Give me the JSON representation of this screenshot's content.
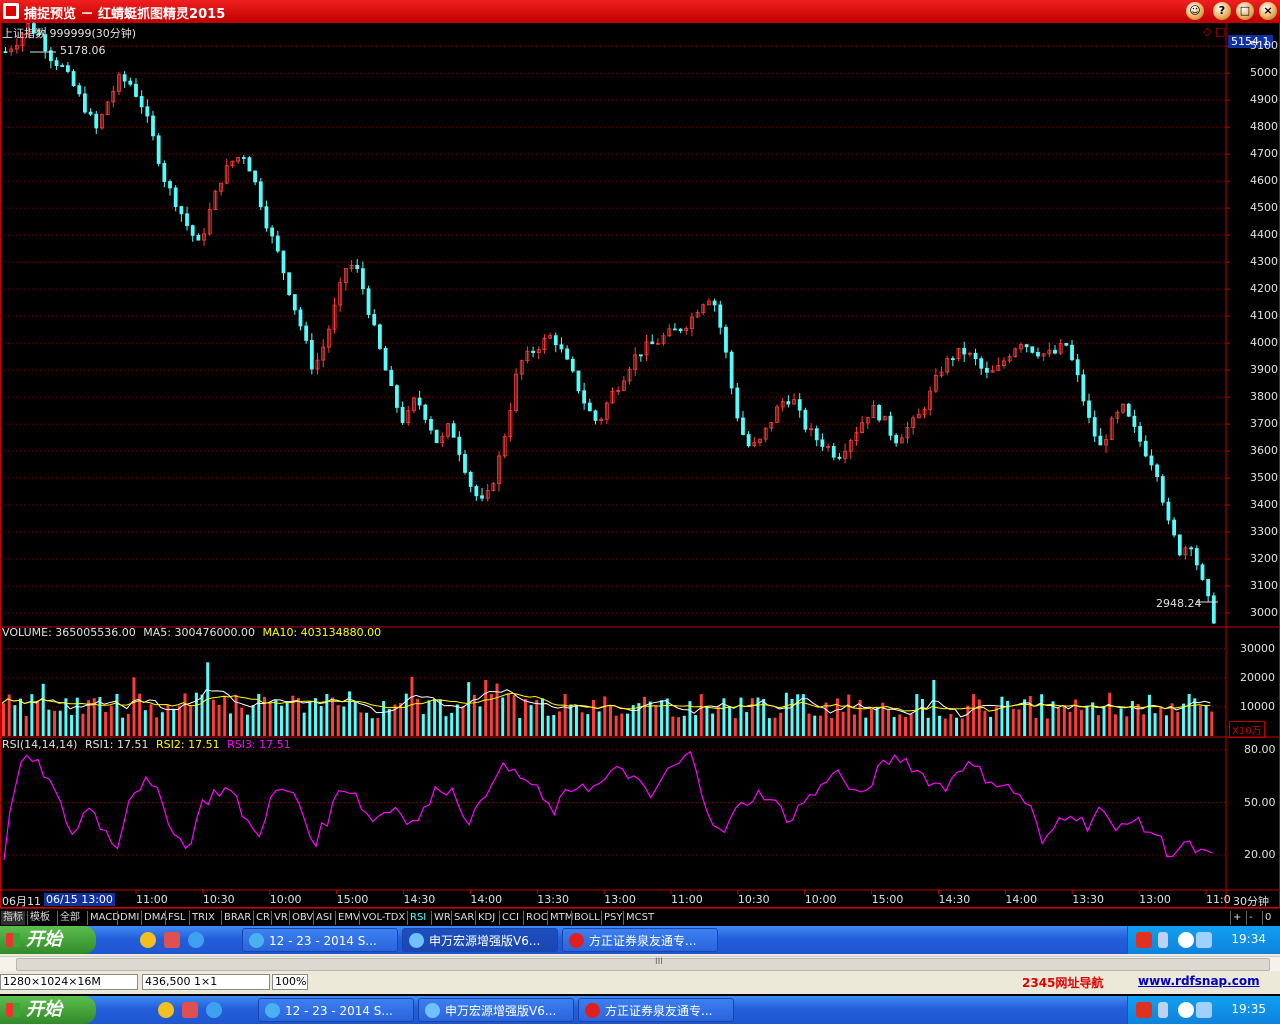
{
  "window": {
    "title": "捕捉预览 － 红蜻蜓抓图精灵2015",
    "buttons": [
      "☺",
      "?",
      "□",
      "×"
    ]
  },
  "chart_header": {
    "symbol": "上证指数 999999(30分钟)",
    "high_label": "5178.06",
    "low_label": "2948.24",
    "current_price": "5154.1",
    "corner_icons": "◇ □"
  },
  "price_axis": [
    "5100",
    "5000",
    "4900",
    "4800",
    "4700",
    "4600",
    "4500",
    "4400",
    "4300",
    "4200",
    "4100",
    "4000",
    "3900",
    "3800",
    "3700",
    "3600",
    "3500",
    "3400",
    "3300",
    "3200",
    "3100",
    "3000"
  ],
  "volume_panel": {
    "label": "VOLUME: 365005536.00",
    "ma5": "MA5: 300476000.00",
    "ma10": "MA10: 403134880.00",
    "axis": [
      "30000",
      "20000",
      "10000"
    ],
    "unit": "X10万"
  },
  "rsi_panel": {
    "label": "RSI(14,14,14)",
    "rsi1": "RSI1: 17.51",
    "rsi2": "RSI2: 17.51",
    "rsi3": "RSI3: 17.51",
    "axis": [
      "80.00",
      "50.00",
      "20.00"
    ]
  },
  "time_axis": {
    "first": "06月11",
    "cursor": "06/15 13:00",
    "ticks": [
      "11:00",
      "10:30",
      "10:00",
      "15:00",
      "14:30",
      "14:00",
      "13:30",
      "13:00",
      "11:00",
      "10:30",
      "10:00",
      "15:00",
      "14:30",
      "14:00",
      "13:30",
      "13:00",
      "11:0"
    ],
    "period": "30分钟"
  },
  "indicator_tabs": [
    "指标",
    "模板",
    "全部",
    "MACD",
    "DMI",
    "DMA",
    "FSL",
    "TRIX",
    "BRAR",
    "CR",
    "VR",
    "OBV",
    "ASI",
    "EMV",
    "VOL-TDX",
    "RSI",
    "WR",
    "SAR",
    "KDJ",
    "CCI",
    "ROC",
    "MTM",
    "BOLL",
    "PSY",
    "MCST"
  ],
  "tab_controls": [
    "+",
    "-",
    "0"
  ],
  "colors": {
    "up": "#ff3c3c",
    "down": "#54fcfc",
    "rsi": "#ff00ff",
    "ma5": "#ffffff",
    "ma10": "#ffff00",
    "grid": "#800000",
    "axis": "#c00000"
  },
  "taskbar_top": {
    "start": "开始",
    "tasks": [
      "12 - 23 - 2014 S...",
      "申万宏源增强版V6...",
      "方正证券泉友通专..."
    ],
    "clock": "19:34"
  },
  "status": {
    "resolution": "1280×1024×16M",
    "position": "436,500  1×1",
    "zoom": "100%",
    "scroll_grip": "III",
    "nav_link1": "2345网址导航",
    "nav_link2": "www.rdfsnap.com"
  },
  "taskbar_bottom": {
    "start": "开始",
    "tasks": [
      "12 - 23 - 2014 S...",
      "申万宏源增强版V6...",
      "方正证券泉友通专..."
    ],
    "clock": "19:35"
  },
  "chart_data": {
    "type": "candlestick",
    "title": "上证指数 999999(30分钟)",
    "ylim": [
      2930,
      5200
    ],
    "price_path": [
      5080,
      5120,
      5178,
      5140,
      5060,
      5020,
      4950,
      4870,
      4790,
      4900,
      4980,
      4960,
      4880,
      4750,
      4600,
      4520,
      4430,
      4360,
      4500,
      4620,
      4680,
      4700,
      4580,
      4430,
      4320,
      4180,
      4050,
      3900,
      4000,
      4150,
      4300,
      4260,
      4100,
      3950,
      3800,
      3700,
      3800,
      3720,
      3620,
      3700,
      3580,
      3450,
      3400,
      3520,
      3700,
      3920,
      3960,
      4000,
      4030,
      3950,
      3860,
      3760,
      3700,
      3800,
      3860,
      3940,
      3980,
      4000,
      4030,
      4050,
      4080,
      4150,
      4180,
      4010,
      3760,
      3620,
      3620,
      3700,
      3780,
      3800,
      3700,
      3650,
      3620,
      3580,
      3640,
      3700,
      3760,
      3720,
      3640,
      3680,
      3720,
      3800,
      3900,
      3950,
      3970,
      3940,
      3880,
      3900,
      3960,
      4010,
      3980,
      3960,
      3960,
      4000,
      3880,
      3720,
      3610,
      3700,
      3760,
      3680,
      3600,
      3530,
      3330,
      3230,
      3260,
      3110,
      2980
    ],
    "rsi_path": [
      20,
      72,
      74,
      66,
      48,
      30,
      50,
      36,
      24,
      56,
      62,
      54,
      36,
      22,
      48,
      56,
      58,
      44,
      30,
      52,
      58,
      50,
      26,
      40,
      60,
      56,
      40,
      44,
      48,
      38,
      46,
      60,
      56,
      40,
      48,
      70,
      68,
      64,
      56,
      44,
      54,
      62,
      58,
      64,
      70,
      62,
      52,
      66,
      72,
      78,
      48,
      30,
      44,
      52,
      56,
      48,
      40,
      52,
      56,
      70,
      60,
      52,
      66,
      74,
      76,
      68,
      62,
      58,
      72,
      70,
      64,
      60,
      56,
      48,
      24,
      40,
      46,
      36,
      48,
      32,
      42,
      36,
      32,
      20,
      26,
      22,
      18
    ]
  }
}
